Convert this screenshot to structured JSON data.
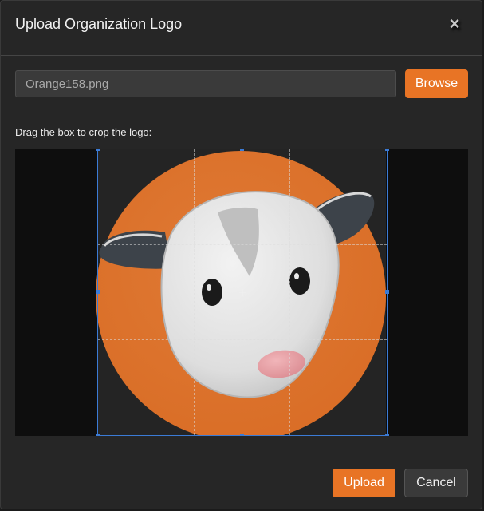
{
  "dialog": {
    "title": "Upload Organization Logo",
    "close_glyph": "×"
  },
  "file": {
    "value": "Orange158.png",
    "browse_label": "Browse"
  },
  "crop": {
    "instruction": "Drag the box to crop the logo:",
    "image_description": "opossum-logo"
  },
  "footer": {
    "upload_label": "Upload",
    "cancel_label": "Cancel"
  },
  "colors": {
    "accent": "#e87425",
    "crop_border": "#3b7bd6",
    "panel": "#262626"
  }
}
